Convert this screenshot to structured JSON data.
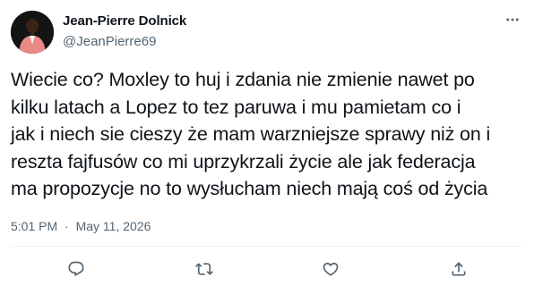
{
  "author": {
    "display_name": "Jean-Pierre Dolnick",
    "handle": "@JeanPierre69"
  },
  "tweet": {
    "text": "Wiecie co? Moxley to huj i zdania nie zmienie nawet po\nkilku latach a Lopez to tez paruwa i mu pamietam co i\njak i niech sie cieszy że mam warzniejsze sprawy niż on i\nreszta fajfusów co mi uprzykrzali życie ale jak federacja\nma propozycje no to wysłucham niech mają coś od życia",
    "time": "5:01 PM",
    "separator": "·",
    "date": "May 11, 2026"
  },
  "icons": {
    "more": "more-icon",
    "reply": "reply-icon",
    "retweet": "retweet-icon",
    "like": "like-icon",
    "share": "share-icon"
  },
  "colors": {
    "text": "#0f1419",
    "secondary": "#536471",
    "divider": "#eff3f4"
  }
}
